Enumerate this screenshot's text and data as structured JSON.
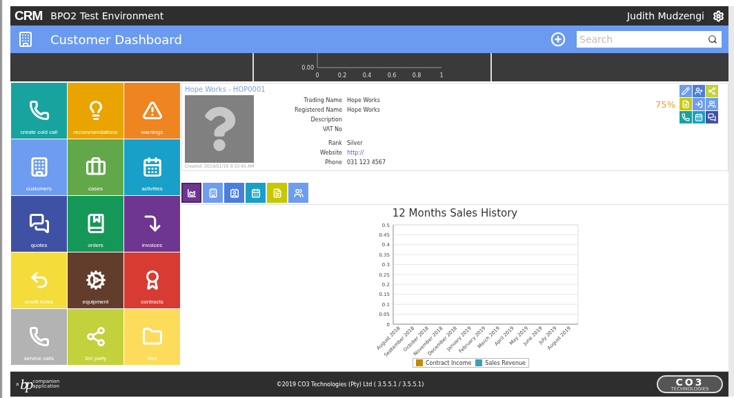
{
  "app": {
    "logo": "CRM",
    "title": "BPO2 Test Environment",
    "user": "Judith Mudzengi"
  },
  "header": {
    "title": "Customer Dashboard",
    "search": {
      "placeholder": "Search"
    }
  },
  "mini_chart": {
    "y_label": "0.00",
    "x_labels": [
      "0",
      "0.2",
      "0.4",
      "0.6",
      "0.8",
      "1"
    ]
  },
  "tiles": [
    {
      "label": "create cold call",
      "color": "#18a39f"
    },
    {
      "label": "recommendations",
      "color": "#eaa400"
    },
    {
      "label": "warnings",
      "color": "#ee8520"
    },
    {
      "label": "customers",
      "color": "#6e9cf0"
    },
    {
      "label": "cases",
      "color": "#62a84a"
    },
    {
      "label": "activities",
      "color": "#18a0c8"
    },
    {
      "label": "quotes",
      "color": "#3f51a5"
    },
    {
      "label": "orders",
      "color": "#159857"
    },
    {
      "label": "invoices",
      "color": "#6e3591"
    },
    {
      "label": "credit notes",
      "color": "#f4dd3a"
    },
    {
      "label": "equipment",
      "color": "#633d2c"
    },
    {
      "label": "contracts",
      "color": "#d83b32"
    },
    {
      "label": "service calls",
      "color": "#b3b3b3"
    },
    {
      "label": "3rd party",
      "color": "#c2d13c"
    },
    {
      "label": "files",
      "color": "#fcdc5a"
    }
  ],
  "customer": {
    "title": "Hope Works - HOP0001",
    "created": "Created: 2019/01/18 9:33:45 AM",
    "field_groups": [
      [
        {
          "label": "Trading Name",
          "value": "Hope Works"
        },
        {
          "label": "Registered Name",
          "value": "Hope Works"
        },
        {
          "label": "Description"
        },
        {
          "label": "VAT No"
        }
      ],
      [
        {
          "label": "Rank",
          "value": "Silver"
        },
        {
          "label": "Website",
          "value": "http://",
          "kind": "link"
        },
        {
          "label": "Phone",
          "value": "031 123 4567"
        }
      ]
    ],
    "completion": "75%",
    "actions": [
      {
        "color": "#6e9cf0"
      },
      {
        "color": "#4a7fe0"
      },
      {
        "color": "#c2d13c"
      },
      {
        "color": "#c8c800"
      },
      {
        "color": "#6e9cf0"
      },
      {
        "color": "#6e9cf0"
      },
      {
        "color": "#18a39f"
      },
      {
        "color": "#18a0c8"
      },
      {
        "color": "#3f51a5"
      }
    ]
  },
  "tabs": [
    {
      "selected": true,
      "color": "#6e3591"
    },
    {
      "selected": false,
      "color": "#6e9cf0"
    },
    {
      "selected": false,
      "color": "#4a7fe0"
    },
    {
      "selected": false,
      "color": "#18a0c8"
    },
    {
      "selected": false,
      "color": "#c8c800"
    },
    {
      "selected": false,
      "color": "#6e9cf0"
    }
  ],
  "sales_chart": {
    "chart_data": {
      "type": "bar",
      "title": "12 Months Sales History",
      "grid": true,
      "categories": [
        "August 2018",
        "September 2018",
        "October 2018",
        "November 2018",
        "December 2018",
        "January 2019",
        "February 2019",
        "March 2019",
        "April 2019",
        "May 2019",
        "June 2019",
        "July 2019",
        "August 2019"
      ],
      "ylim": [
        0,
        0.5
      ],
      "yticks": [
        0,
        0.05,
        0.1,
        0.15,
        0.2,
        0.25,
        0.3,
        0.35,
        0.4,
        0.45,
        0.5
      ],
      "series": [
        {
          "name": "Contract Income",
          "color": "#c48a00",
          "values": [
            null,
            null,
            null,
            null,
            null,
            null,
            null,
            null,
            null,
            null,
            null,
            null,
            null
          ]
        },
        {
          "name": "Sales Revenue",
          "color": "#3aa0b8",
          "values": [
            null,
            null,
            null,
            null,
            null,
            null,
            null,
            null,
            null,
            null,
            null,
            null,
            null
          ]
        }
      ]
    }
  },
  "footer": {
    "logo_prefix": "a",
    "logo_mark": "bp",
    "logo_text": "companion application",
    "copyright": "©2019 CO3 Technologies (Pty) Ltd ( 3.5.5.1 / 3.5.5.1)",
    "brand": "CO3",
    "brand_sub": "TECHNOLOGIES"
  }
}
